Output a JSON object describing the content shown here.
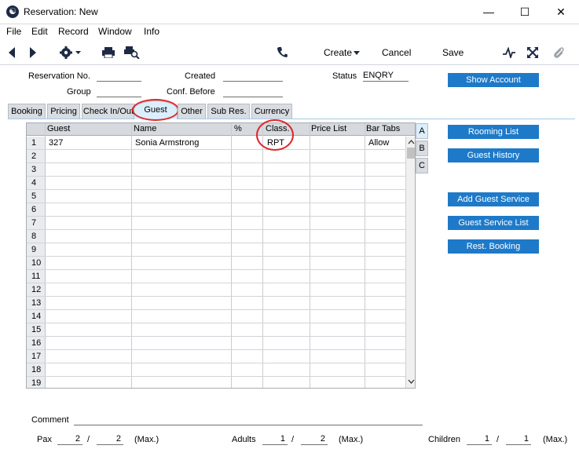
{
  "window": {
    "title": "Reservation: New",
    "minimize": "—",
    "maximize": "☐",
    "close": "✕"
  },
  "menu": [
    "File",
    "Edit",
    "Record",
    "Window",
    "Info"
  ],
  "toolbar": {
    "create": "Create",
    "cancel": "Cancel",
    "save": "Save"
  },
  "header": {
    "reservation_no_label": "Reservation No.",
    "created_label": "Created",
    "status_label": "Status",
    "status_value": "ENQRY",
    "group_label": "Group",
    "conf_before_label": "Conf. Before"
  },
  "tabs": [
    "Booking",
    "Pricing",
    "Check In/Out",
    "Guest",
    "Other",
    "Sub Res.",
    "Currency"
  ],
  "active_tab": "Guest",
  "grid": {
    "columns": [
      "Guest",
      "Name",
      "%",
      "Class.",
      "Price List",
      "Bar Tabs"
    ],
    "rows": [
      {
        "num": "1",
        "guest": "327",
        "name": "Sonia Armstrong",
        "class": "RPT",
        "bar_tabs": "Allow"
      },
      {
        "num": "2"
      },
      {
        "num": "3"
      },
      {
        "num": "4"
      },
      {
        "num": "5"
      },
      {
        "num": "6"
      },
      {
        "num": "7"
      },
      {
        "num": "8"
      },
      {
        "num": "9"
      },
      {
        "num": "10"
      },
      {
        "num": "11"
      },
      {
        "num": "12"
      },
      {
        "num": "13"
      },
      {
        "num": "14"
      },
      {
        "num": "15"
      },
      {
        "num": "16"
      },
      {
        "num": "17"
      },
      {
        "num": "18"
      },
      {
        "num": "19"
      }
    ]
  },
  "side_tabs": [
    "A",
    "B",
    "C"
  ],
  "buttons": {
    "show_account": "Show Account",
    "rooming_list": "Rooming List",
    "guest_history": "Guest History",
    "add_guest_service": "Add Guest Service",
    "guest_service_list": "Guest Service List",
    "rest_booking": "Rest. Booking"
  },
  "footer": {
    "comment_label": "Comment",
    "pax_label": "Pax",
    "pax_value": "2",
    "pax_max": "2",
    "adults_label": "Adults",
    "adults_value": "1",
    "adults_max": "2",
    "children_label": "Children",
    "children_value": "1",
    "children_max": "1",
    "max_label": "(Max.)",
    "slash": "/"
  }
}
